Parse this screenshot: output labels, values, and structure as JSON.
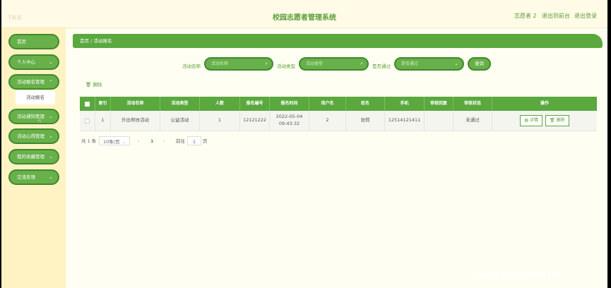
{
  "header": {
    "logo_text": "下标志",
    "title": "校园志愿者管理系统",
    "user": "志愿者 2",
    "back_link": "退出到前台",
    "logout_link": "退出登录"
  },
  "sidebar": {
    "items": [
      {
        "label": "首页",
        "chevron": ""
      },
      {
        "label": "个人中心",
        "chevron": "⌄"
      },
      {
        "label": "活动报名管理",
        "chevron": "⌃"
      },
      {
        "label": "活动通知管理",
        "chevron": "⌄"
      },
      {
        "label": "活动心得管理",
        "chevron": "⌄"
      },
      {
        "label": "我的收藏管理",
        "chevron": "⌄"
      },
      {
        "label": "交流反馈",
        "chevron": "⌄"
      }
    ],
    "submenu_item": "活动报名"
  },
  "breadcrumb": "首页 / 活动报名",
  "search": {
    "name_label": "活动名称",
    "name_placeholder": "活动名称",
    "type_label": "活动类型",
    "type_placeholder": "活动类型",
    "pass_label": "是否通过",
    "pass_placeholder": "是否通过",
    "query_button": "查询"
  },
  "toolbar": {
    "delete_label": "删除"
  },
  "table": {
    "headers": [
      "",
      "索引",
      "活动名称",
      "活动类型",
      "人数",
      "报名编号",
      "报名时间",
      "用户名",
      "姓名",
      "手机",
      "审核回复",
      "审核状态",
      "操作"
    ],
    "rows": [
      {
        "index": "1",
        "name": "外出帮扶活动",
        "type": "公益活动",
        "count": "1",
        "reg_no": "12121222",
        "reg_time": "2022-05-04 09:43:32",
        "username": "2",
        "realname": "张莉",
        "phone": "12514121411",
        "reply": "",
        "status": "未通过",
        "detail_label": "详情",
        "delete_label": "删除"
      }
    ]
  },
  "pager": {
    "total": "共 1 条",
    "page_size": "10条/页",
    "prev": "‹",
    "current": "1",
    "next": "›",
    "goto_label": "前往",
    "goto_value": "1",
    "page_suffix": "页"
  },
  "watermark": "CSDN @昊言likeJava",
  "colors": {
    "accent": "#5aa83e",
    "sidebar_bg": "#fff3c4"
  }
}
